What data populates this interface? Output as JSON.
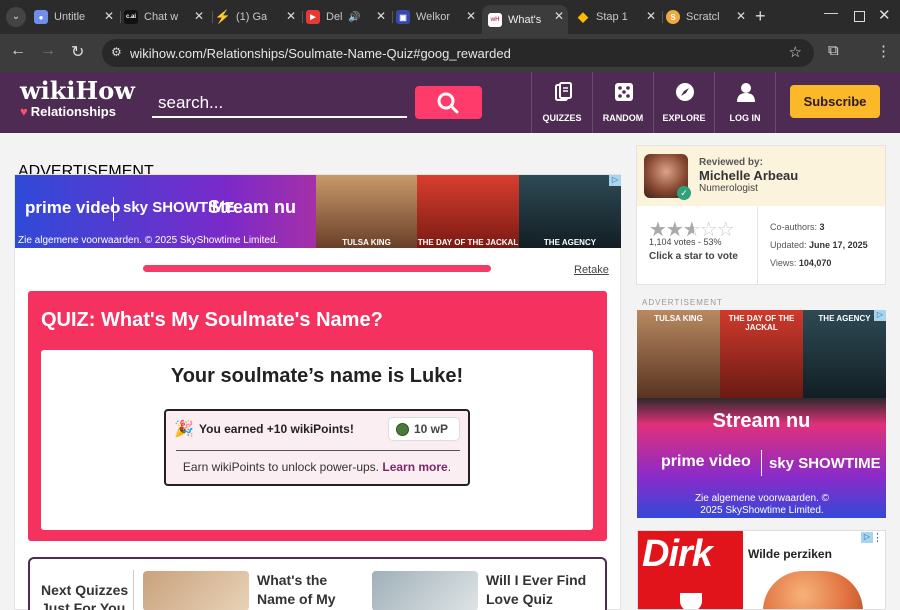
{
  "browser": {
    "tabs": [
      {
        "title": "Untitle",
        "color": "#6e8ee8"
      },
      {
        "title": "Chat w",
        "color": "#111111",
        "text": "c.ai"
      },
      {
        "title": "(1) Ga",
        "color": "#2e8b57"
      },
      {
        "title": "Del",
        "color": "#e53935"
      },
      {
        "title": "Welkor",
        "color": "#3949ab"
      },
      {
        "title": "What's",
        "color": "#d8357a"
      },
      {
        "title": "Stap 1",
        "color": "#fbbc05"
      },
      {
        "title": "Scratcl",
        "color": "#f2a93b"
      }
    ],
    "url": "wikihow.com/Relationships/Soulmate-Name-Quiz#goog_rewarded"
  },
  "header": {
    "logo": "wikiHow",
    "sublogo": "Relationships",
    "search_placeholder": "search...",
    "nav": [
      "QUIZZES",
      "RANDOM",
      "EXPLORE",
      "LOG IN"
    ],
    "subscribe": "Subscribe"
  },
  "ad_top": {
    "label": "ADVERTISEMENT",
    "brand1": "prime video",
    "brand2": "sky SHOWTIME",
    "cta": "Stream nu",
    "disclaimer": "Zie algemene voorwaarden. © 2025 SkyShowtime Limited.",
    "movies": [
      "TULSA KING",
      "THE DAY OF THE JACKAL",
      "THE AGENCY"
    ]
  },
  "quiz": {
    "progress": 1.0,
    "retake": "Retake",
    "title": "QUIZ: What's My Soulmate's Name?",
    "result": "Your soulmate’s name is Luke!",
    "earned": "You earned +10 wikiPoints!",
    "wp": "10 wP",
    "earn_text": "Earn wikiPoints to unlock power-ups.",
    "learn_more": "Learn more",
    "period": "."
  },
  "next": {
    "heading": "Next Quizzes Just For You",
    "items": [
      "What's the Name of My",
      "Will I Ever Find Love Quiz"
    ]
  },
  "sidebar": {
    "reviewed_by": "Reviewed by:",
    "name": "Michelle Arbeau",
    "role": "Numerologist",
    "rating": 2.65,
    "votes": "1,104 votes - 53%",
    "click_star": "Click a star to vote",
    "coauthors_label": "Co-authors:",
    "coauthors": "3",
    "updated_label": "Updated:",
    "updated": "June 17, 2025",
    "views_label": "Views:",
    "views": "104,070",
    "ad_label": "ADVERTISEMENT",
    "ad_movies": [
      "TULSA KING",
      "THE DAY OF THE JACKAL",
      "THE AGENCY"
    ],
    "ad_cta": "Stream nu",
    "ad_brand1": "prime video",
    "ad_brand2": "sky SHOWTIME",
    "ad_disclaimer": "Zie algemene voorwaarden. © 2025 SkyShowtime Limited.",
    "dirk_logo": "Dirk",
    "dirk_text": "Wilde perziken"
  }
}
